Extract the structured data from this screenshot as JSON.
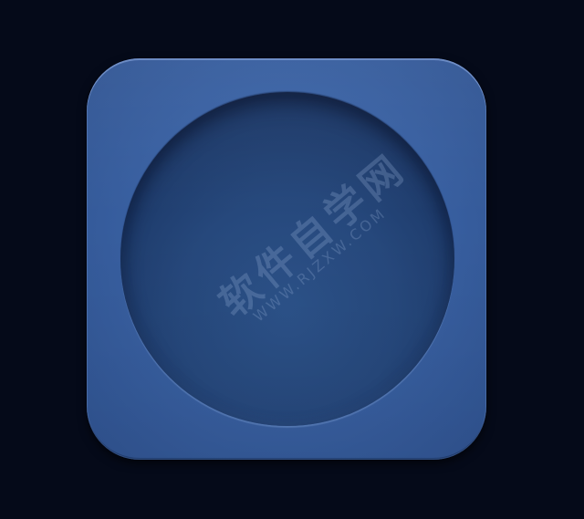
{
  "colors": {
    "background": "#050a19",
    "icon_face": "#3a62a4",
    "disc": "#1f3d6e"
  },
  "watermark": {
    "title": "软件自学网",
    "url": "WWW.RJZXW.COM"
  }
}
